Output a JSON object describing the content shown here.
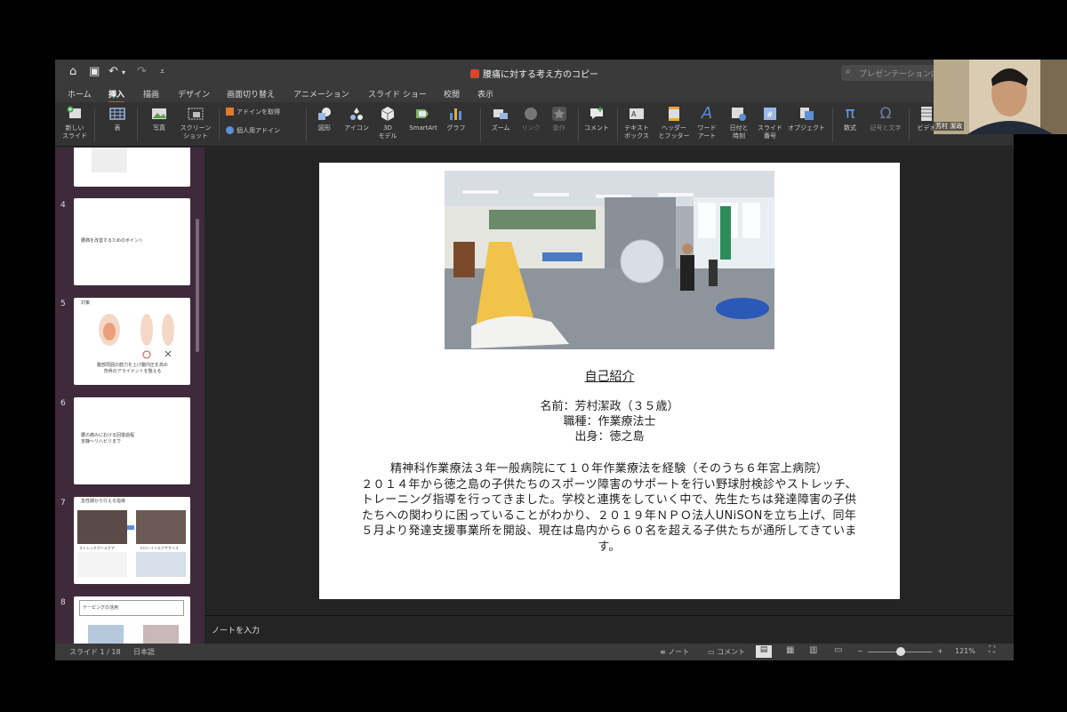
{
  "window": {
    "title": "腰痛に対する考え方のコピー",
    "search_placeholder": "プレゼンテーション内"
  },
  "tabs": [
    {
      "label": "ホーム"
    },
    {
      "label": "挿入"
    },
    {
      "label": "描画"
    },
    {
      "label": "デザイン"
    },
    {
      "label": "画面切り替え"
    },
    {
      "label": "アニメーション"
    },
    {
      "label": "スライド ショー"
    },
    {
      "label": "校閲"
    },
    {
      "label": "表示"
    }
  ],
  "ribbon": {
    "new_slide": "新しい\nスライド",
    "table": "表",
    "photo": "写真",
    "screenshot": "スクリーン\nショット",
    "get_addins": "アドインを取得",
    "my_addins": "個人用アドイン",
    "shapes": "図形",
    "icons": "アイコン",
    "model3d": "3D\nモデル",
    "smartart": "SmartArt",
    "chart": "グラフ",
    "zoom": "ズーム",
    "link": "リンク",
    "action": "動作",
    "comment": "コメント",
    "textbox": "テキスト\nボックス",
    "header_footer": "ヘッダー\nとフッター",
    "wordart": "ワード\nアート",
    "datetime": "日付と\n時刻",
    "slide_number": "スライド\n番号",
    "object": "オブジェクト",
    "equation": "数式",
    "symbol": "記号と文字",
    "video": "ビデオ"
  },
  "thumbnails": [
    {
      "number": "4",
      "text": "腰痛を改善するためのポイント"
    },
    {
      "number": "5",
      "title": "対策",
      "caption": "腹部周囲の筋力を上げ腹内圧を高め\n背骨のアライメントを整える"
    },
    {
      "number": "6",
      "text": "腰の痛みにおける回復過程\n安静〜リハビリまで"
    },
    {
      "number": "7",
      "title": "急性期から行える指導",
      "caption1": "ストレッチポールケア",
      "caption2": "ドローインエクササイズ"
    },
    {
      "number": "8",
      "title": "テーピングの活用"
    }
  ],
  "slide": {
    "heading": "自己紹介",
    "name_line": "名前：芳村潔政（３５歳）",
    "job_line": "職種：作業療法士",
    "origin_line": "出身：徳之島",
    "bio_1": "精神科作業療法３年一般病院にて１０年作業療法を経験（そのうち６年宮上病院）",
    "bio_2": "２０１４年から徳之島の子供たちのスポーツ障害のサポートを行い野球肘検診やストレッチ、トレーニング指導を行ってきました。学校と連携をしていく中で、先生たちは発達障害の子供たちへの関わりに困っていることがわかり、２０１９年ＮＰＯ法人UNiSONを立ち上げ、同年５月より発達支援事業所を開設、現在は島内から６０名を超える子供たちが通所してきています。"
  },
  "notes_placeholder": "ノートを入力",
  "status": {
    "slide_counter": "スライド 1 / 18",
    "language": "日本語",
    "notes": "ノート",
    "comments": "コメント",
    "zoom": "121%"
  },
  "webcam": {
    "label": "芳村 潔政"
  },
  "colors": {
    "accent": "#c8553d",
    "thumb_panel": "#3e2a3a"
  }
}
